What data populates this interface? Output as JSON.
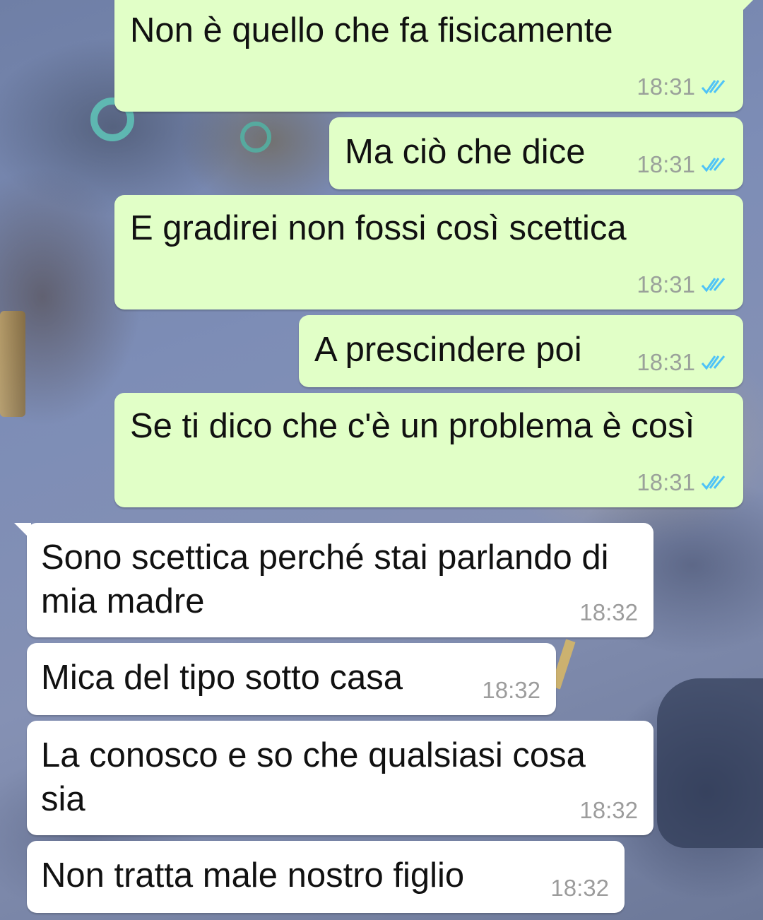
{
  "chat": {
    "outgoing_color": "#e1ffc7",
    "incoming_color": "#ffffff",
    "tick_color": "#4fc3f7",
    "read_receipt_icon": "double-check-icon",
    "messages": [
      {
        "text": "Non è quello che fa fisicamente",
        "time": "18:31"
      },
      {
        "text": "Ma ciò che dice",
        "time": "18:31"
      },
      {
        "text": "E gradirei non fossi così scettica",
        "time": "18:31"
      },
      {
        "text": "A prescindere poi",
        "time": "18:31"
      },
      {
        "text": "Se ti dico che c'è un problema è così",
        "time": "18:31"
      },
      {
        "text": "Sono scettica perché stai parlando di mia madre",
        "time": "18:32"
      },
      {
        "text": "Mica del tipo sotto casa",
        "time": "18:32"
      },
      {
        "text": "La conosco e so che qualsiasi cosa sia",
        "time": "18:32"
      },
      {
        "text": "Non tratta male nostro figlio",
        "time": "18:32"
      }
    ]
  }
}
